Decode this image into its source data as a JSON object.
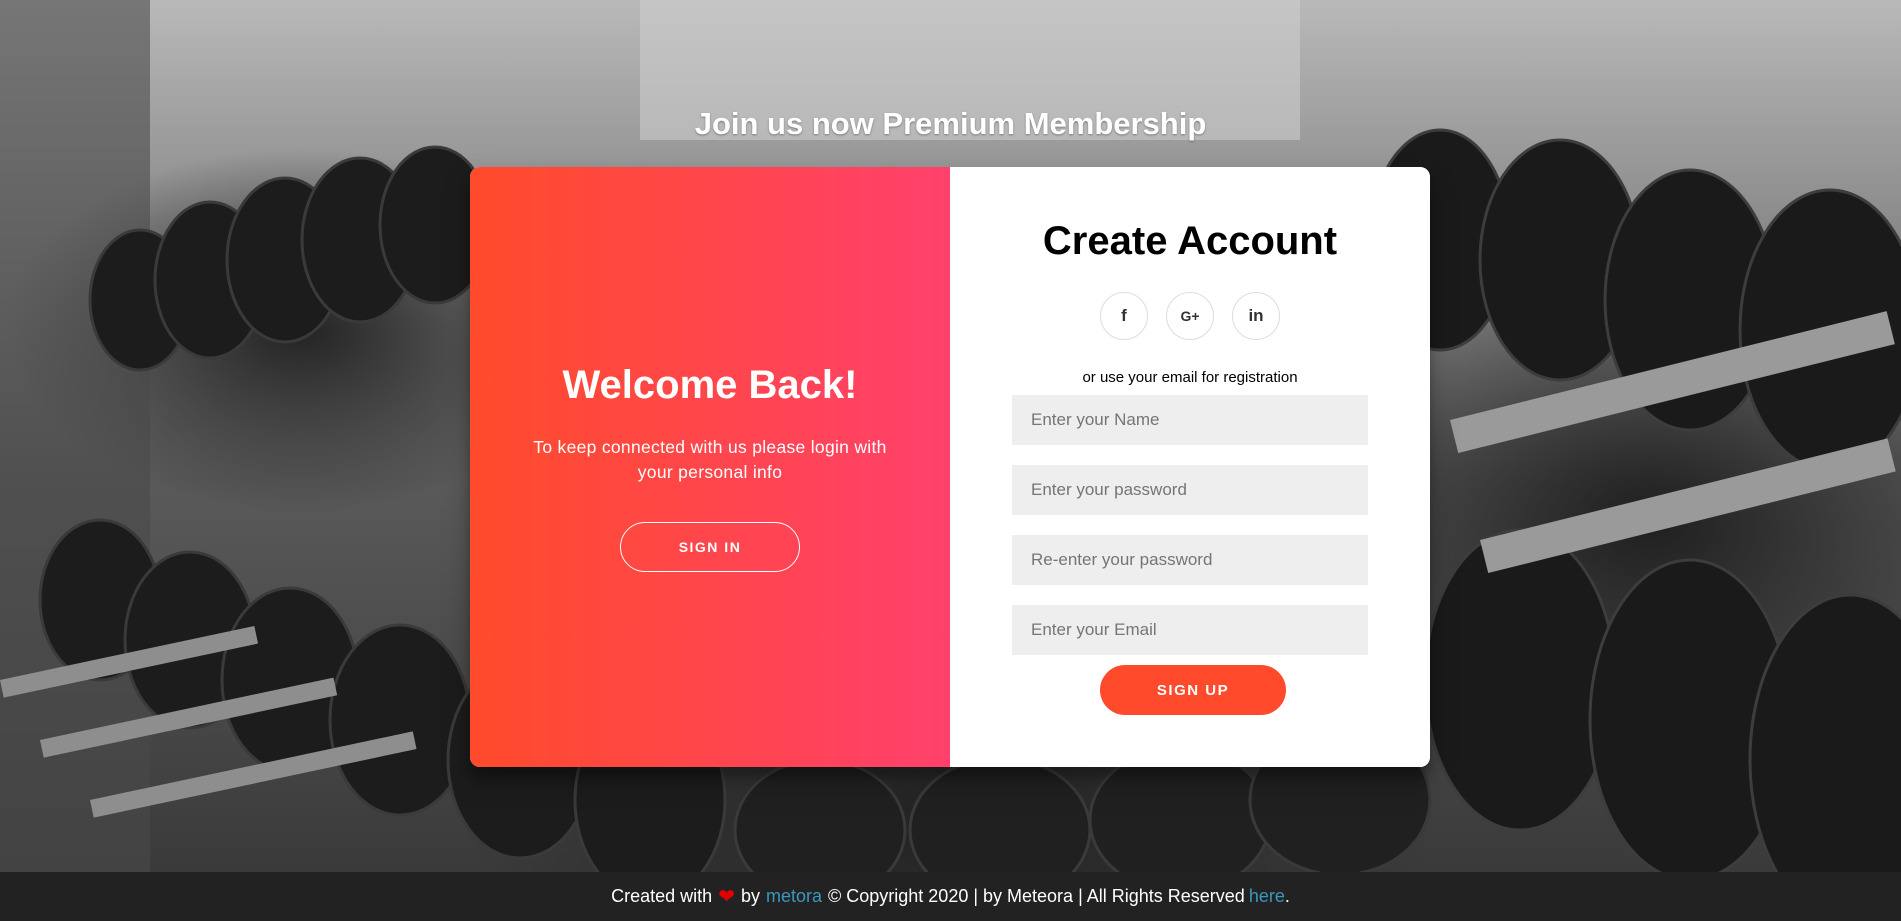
{
  "heading": "Join us now Premium Membership",
  "overlay": {
    "title": "Welcome Back!",
    "text": "To keep connected with us please login with your personal info",
    "button": "SIGN IN"
  },
  "form": {
    "title": "Create Account",
    "social": [
      {
        "label": "f",
        "icon": "facebook-icon"
      },
      {
        "label": "G+",
        "icon": "google-plus-icon"
      },
      {
        "label": "in",
        "icon": "linkedin-icon"
      }
    ],
    "hint": "or use your email for registration",
    "fields": {
      "name": {
        "placeholder": "Enter your Name",
        "value": ""
      },
      "password": {
        "placeholder": "Enter your password",
        "value": ""
      },
      "repassword": {
        "placeholder": "Re-enter your password",
        "value": ""
      },
      "email": {
        "placeholder": "Enter your Email",
        "value": ""
      }
    },
    "submit": "SIGN UP"
  },
  "footer": {
    "prefix": "Created with",
    "heart_icon": "heart-icon",
    "by": "by",
    "author_link": "metora",
    "copyright": "© Copyright 2020 | by Meteora | All Rights Reserved",
    "here_link": "here",
    "suffix": "."
  },
  "colors": {
    "accent": "#ff4b2b",
    "accent_end": "#ff416c",
    "link": "#3c97bf",
    "footer_bg": "#222222"
  }
}
